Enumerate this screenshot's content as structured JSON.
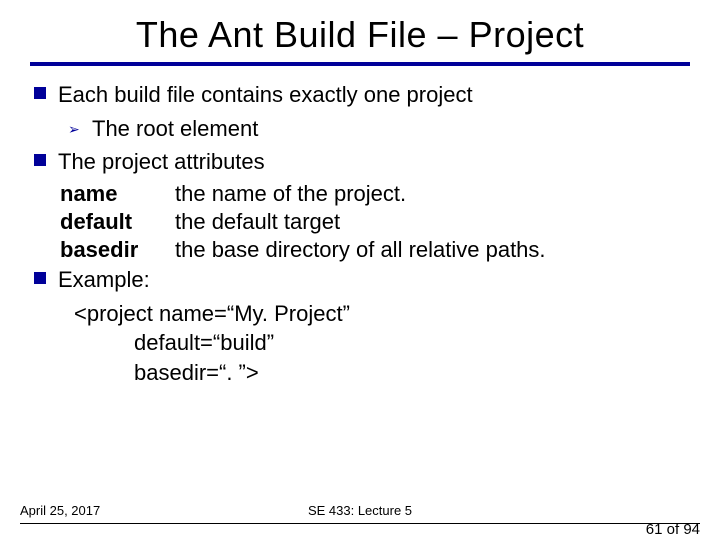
{
  "title": "The Ant Build File – Project",
  "bullets": [
    {
      "text": "Each build file contains exactly one project",
      "sub": [
        {
          "text": "The root element"
        }
      ]
    },
    {
      "text": "The project attributes",
      "attrs": [
        {
          "name": "name",
          "desc": "the name of the project."
        },
        {
          "name": "default",
          "desc": "the default target"
        },
        {
          "name": "basedir",
          "desc": "the base directory of all relative paths."
        }
      ]
    },
    {
      "text": "Example:",
      "example": [
        "<project name=“My. Project”",
        "default=“build”",
        "basedir=“. ”>"
      ]
    }
  ],
  "footer": {
    "date": "April 25, 2017",
    "course": "SE 433: Lecture 5",
    "page_current": "61",
    "page_total": "94",
    "page_sep": " of "
  }
}
